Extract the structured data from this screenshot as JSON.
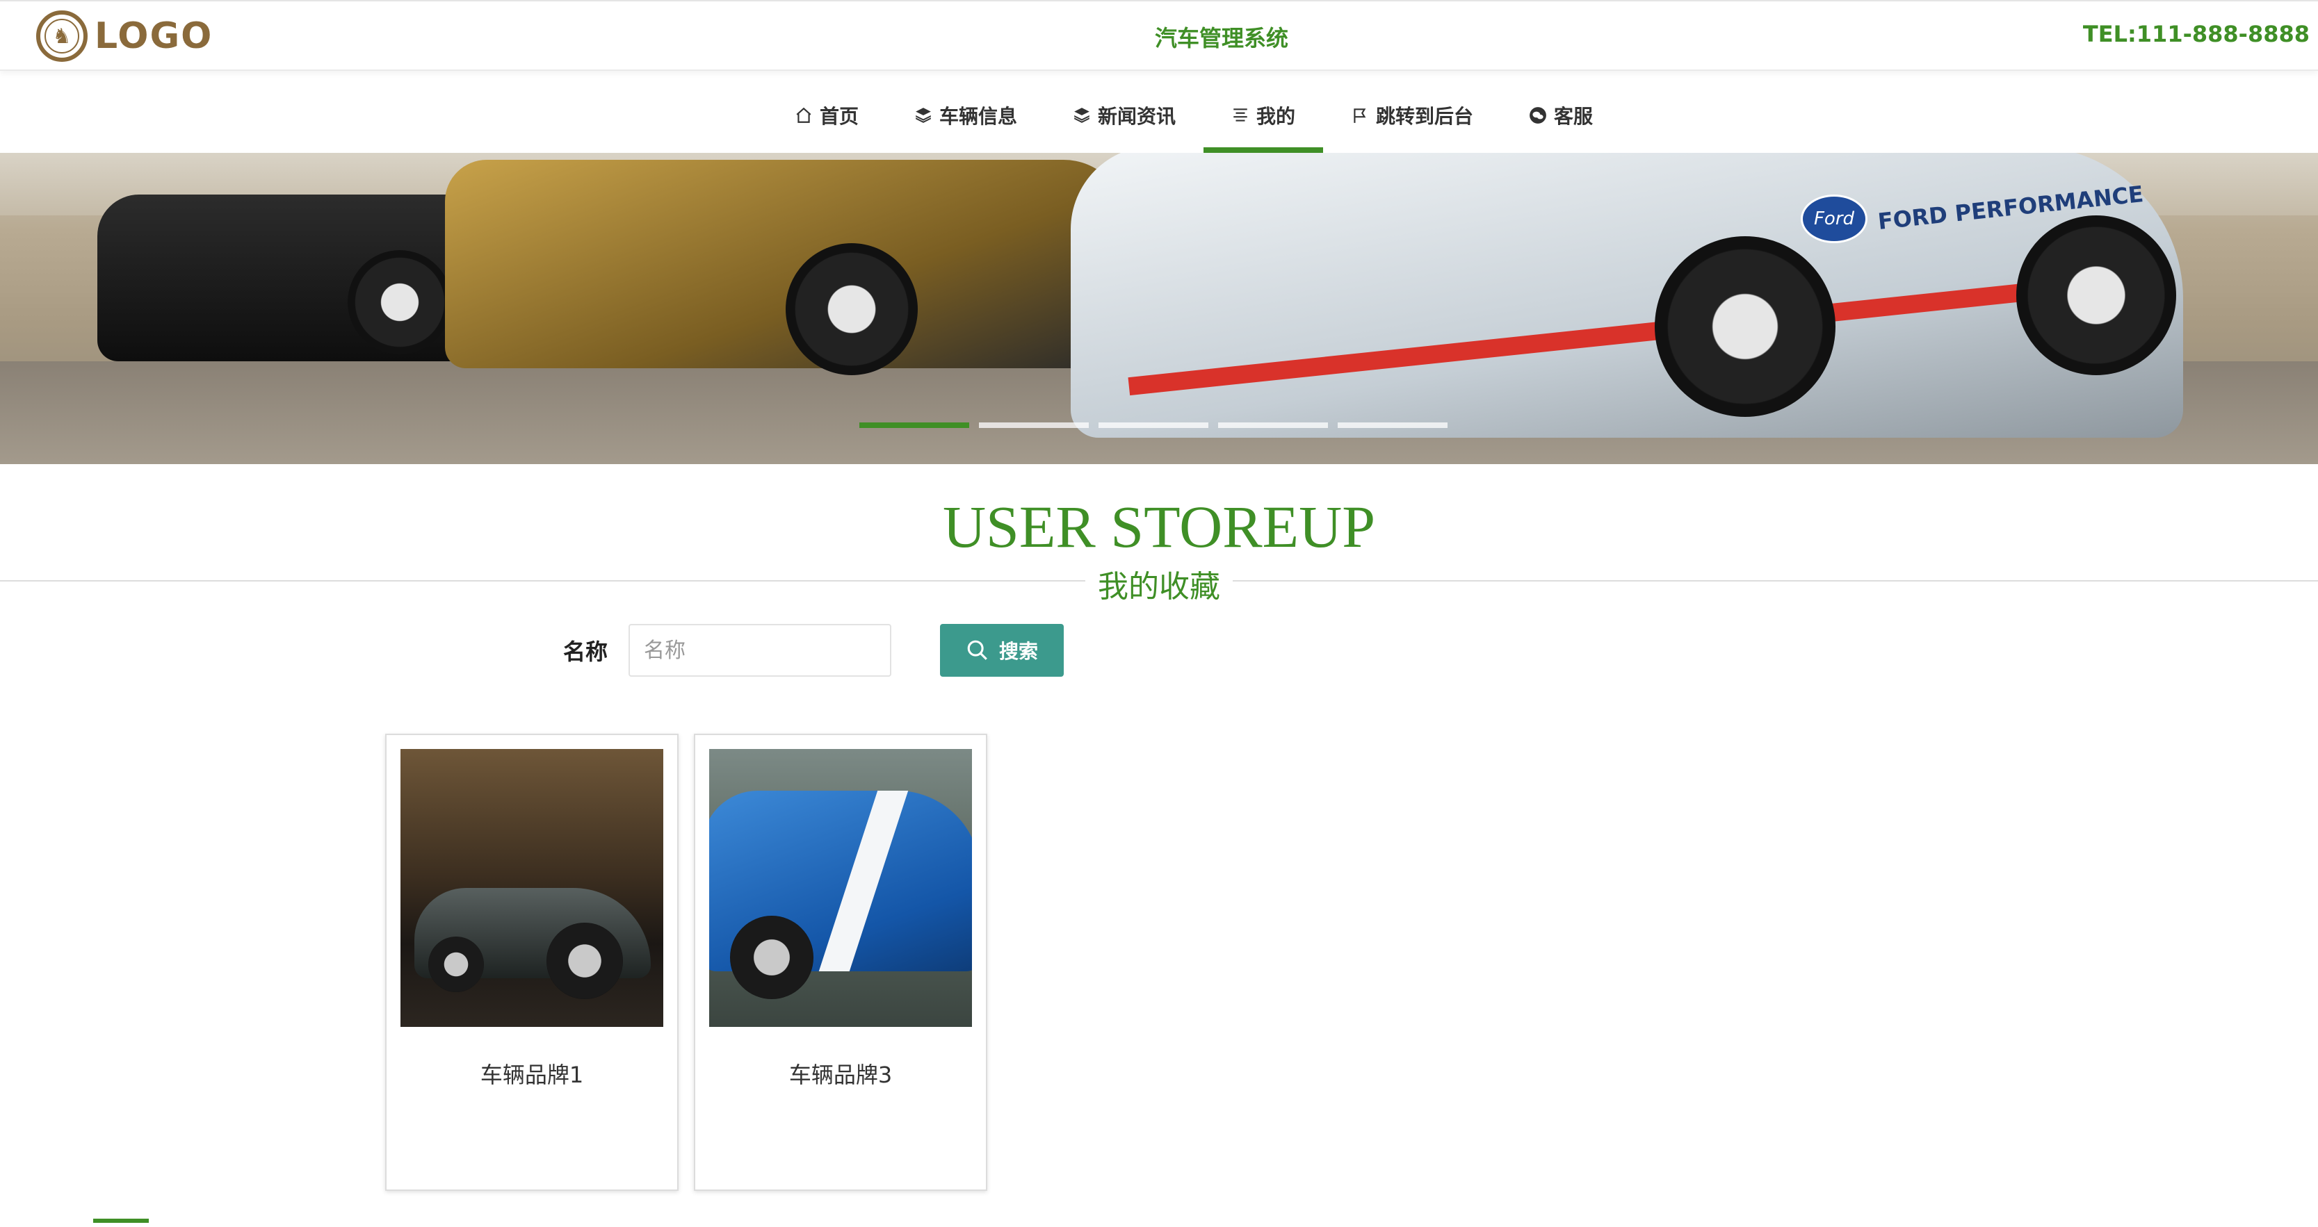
{
  "header": {
    "logo_text": "LOGO",
    "title": "汽车管理系统",
    "tel": "TEL:111-888-8888"
  },
  "nav": {
    "items": [
      {
        "label": "首页",
        "icon": "home-icon"
      },
      {
        "label": "车辆信息",
        "icon": "layers-icon"
      },
      {
        "label": "新闻资讯",
        "icon": "layers-icon"
      },
      {
        "label": "我的",
        "icon": "menu-lines-icon",
        "active": true
      },
      {
        "label": "跳转到后台",
        "icon": "flag-icon"
      },
      {
        "label": "客服",
        "icon": "wechat-icon"
      }
    ]
  },
  "banner": {
    "brand_badge": "Ford",
    "brand_text": "FORD PERFORMANCE",
    "slides": 5,
    "active_slide": 1
  },
  "section": {
    "title_en": "USER STOREUP",
    "title_cn": "我的收藏"
  },
  "search": {
    "label": "名称",
    "placeholder": "名称",
    "value": "",
    "button_label": "搜索"
  },
  "favorites": [
    {
      "name": "车辆品牌1"
    },
    {
      "name": "车辆品牌3"
    }
  ],
  "colors": {
    "accent": "#3f8f26",
    "button": "#3c9a8d",
    "logo": "#8a6a3b"
  }
}
